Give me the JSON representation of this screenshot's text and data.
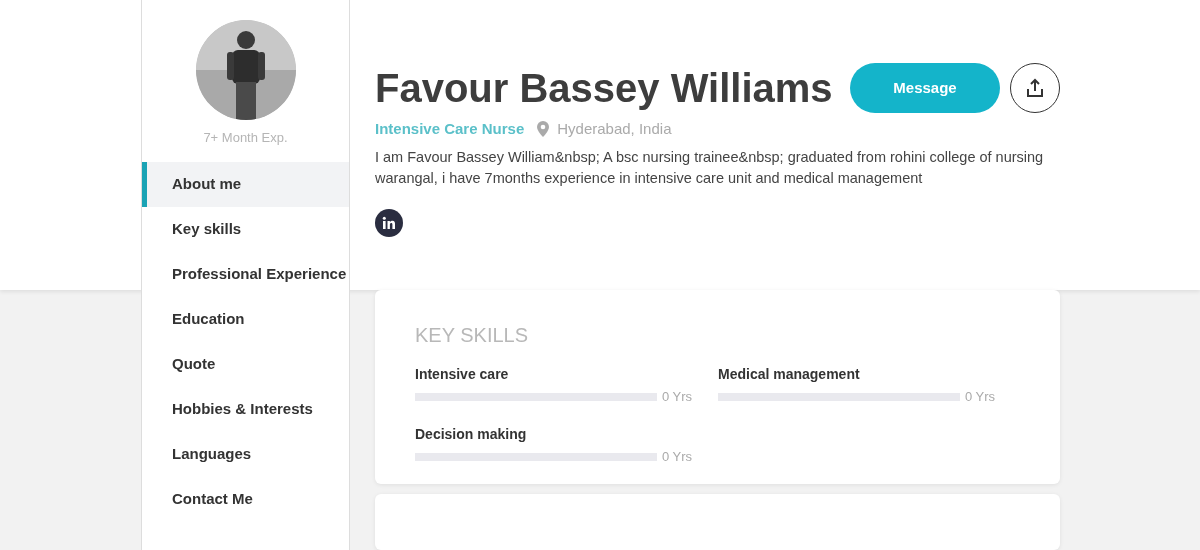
{
  "sidebar": {
    "experience": "7+ Month Exp.",
    "items": [
      {
        "label": "About me",
        "selected": true
      },
      {
        "label": "Key skills",
        "selected": false
      },
      {
        "label": "Professional Experience",
        "selected": false
      },
      {
        "label": "Education",
        "selected": false
      },
      {
        "label": "Quote",
        "selected": false
      },
      {
        "label": "Hobbies & Interests",
        "selected": false
      },
      {
        "label": "Languages",
        "selected": false
      },
      {
        "label": "Contact Me",
        "selected": false
      }
    ]
  },
  "profile": {
    "name": "Favour Bassey Williams",
    "title": "Intensive Care Nurse",
    "location": "Hyderabad, India",
    "bio": "I am Favour Bassey William&nbsp; A bsc nursing trainee&nbsp; graduated from rohini college of nursing warangal, i have 7months experience in intensive care unit and medical management",
    "message_button": "Message"
  },
  "key_skills": {
    "heading": "KEY SKILLS",
    "skills": [
      {
        "name": "Intensive care",
        "level": 0,
        "reading": "0 Yrs"
      },
      {
        "name": "Medical management",
        "level": 0,
        "reading": "0 Yrs"
      },
      {
        "name": "Decision making",
        "level": 0,
        "reading": "0 Yrs"
      }
    ]
  }
}
